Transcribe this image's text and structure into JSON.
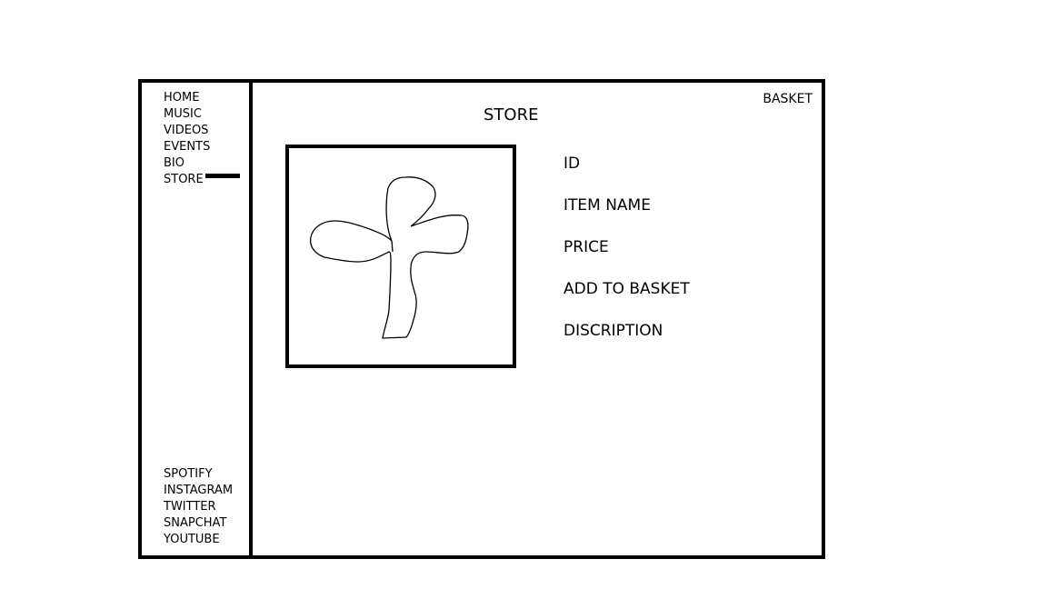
{
  "sidebar": {
    "nav_items": [
      {
        "label": "HOME"
      },
      {
        "label": "MUSIC"
      },
      {
        "label": "VIDEOS"
      },
      {
        "label": "EVENTS"
      },
      {
        "label": "BIO"
      },
      {
        "label": "STORE",
        "active": true
      }
    ],
    "social_links": [
      {
        "label": "SPOTIFY"
      },
      {
        "label": "INSTAGRAM"
      },
      {
        "label": "TWITTER"
      },
      {
        "label": "SNAPCHAT"
      },
      {
        "label": "YOUTUBE"
      }
    ]
  },
  "header": {
    "title": "STORE",
    "basket_label": "BASKET"
  },
  "product": {
    "image_icon": "sprout-icon",
    "id_label": "ID",
    "name_label": "ITEM NAME",
    "price_label": "PRICE",
    "add_to_basket_label": "ADD TO BASKET",
    "description_label": "DISCRIPTION"
  }
}
